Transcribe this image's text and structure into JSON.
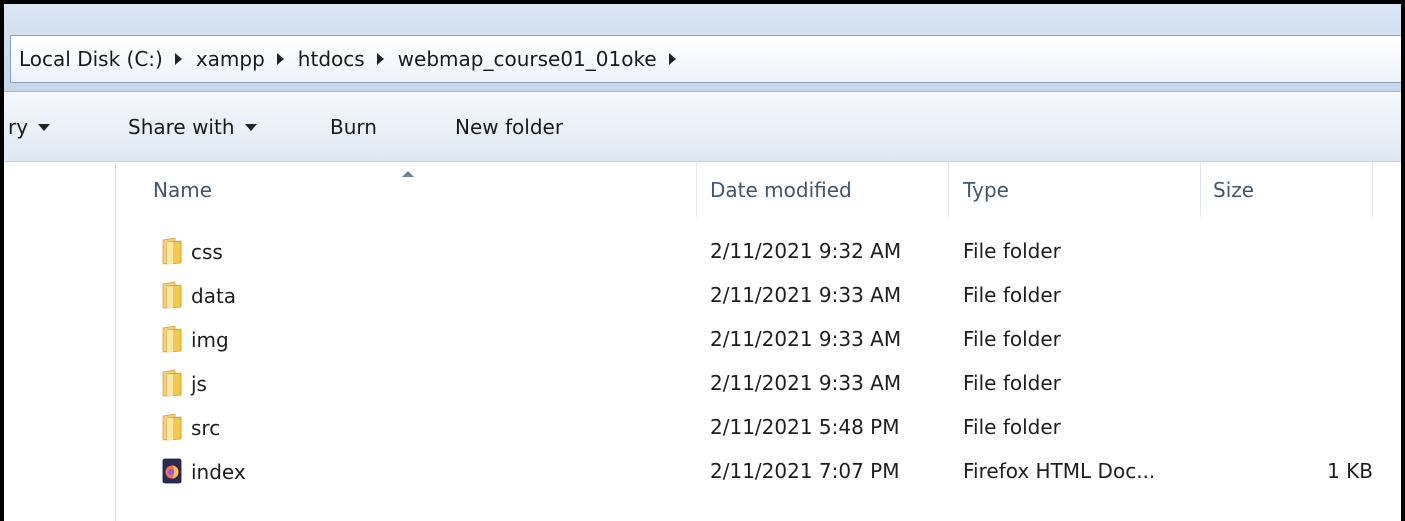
{
  "breadcrumb": [
    {
      "label": "Local Disk (C:)"
    },
    {
      "label": "xampp"
    },
    {
      "label": "htdocs"
    },
    {
      "label": "webmap_course01_01oke"
    }
  ],
  "toolbar": {
    "library_label": "ry",
    "share_label": "Share with",
    "burn_label": "Burn",
    "new_folder_label": "New folder"
  },
  "columns": {
    "name": "Name",
    "date": "Date modified",
    "type": "Type",
    "size": "Size"
  },
  "files": [
    {
      "name": "css",
      "date": "2/11/2021 9:32 AM",
      "type": "File folder",
      "size": "",
      "icon": "folder-icon"
    },
    {
      "name": "data",
      "date": "2/11/2021 9:33 AM",
      "type": "File folder",
      "size": "",
      "icon": "folder-icon"
    },
    {
      "name": "img",
      "date": "2/11/2021 9:33 AM",
      "type": "File folder",
      "size": "",
      "icon": "folder-icon"
    },
    {
      "name": "js",
      "date": "2/11/2021 9:33 AM",
      "type": "File folder",
      "size": "",
      "icon": "folder-icon"
    },
    {
      "name": "src",
      "date": "2/11/2021 5:48 PM",
      "type": "File folder",
      "size": "",
      "icon": "folder-icon"
    },
    {
      "name": "index",
      "date": "2/11/2021 7:07 PM",
      "type": "Firefox HTML Doc...",
      "size": "1 KB",
      "icon": "firefox-html-icon"
    }
  ],
  "colors": {
    "folder": "#f2c94c",
    "header_text": "#44546a",
    "window_border": "#000000"
  }
}
